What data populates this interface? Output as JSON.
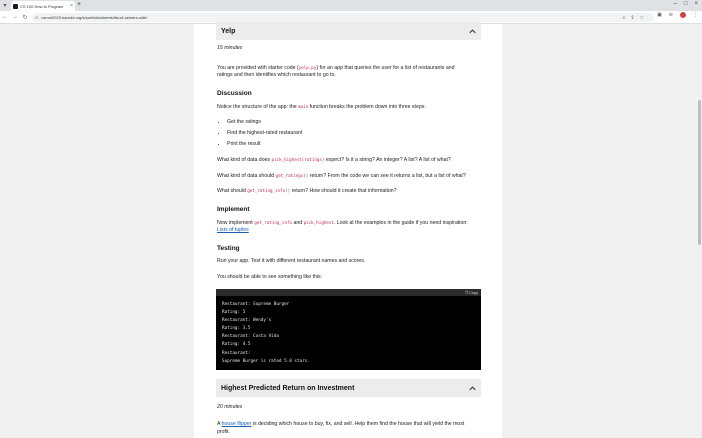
{
  "browser": {
    "tab_title": "CS 100 How to Program",
    "url": "csmm2023.harrold.org/s/portfolio/sheets/list-of-seiners-with/",
    "colors": {
      "accent": "#1a5fb4",
      "code_red": "#c7254e"
    }
  },
  "yelp": {
    "title": "Yelp",
    "time": "15 minutes",
    "intro_a": "You are provided with starter code (",
    "intro_code": "yelp.py",
    "intro_b": ") for an app that queries the user for a list of restaurants and",
    "intro_line2": "ratings and then identifies which restaurant to go to.",
    "discussion_heading": "Discussion",
    "discussion_a": "Notice the structure of the app: the ",
    "discussion_code": "main",
    "discussion_b": " function breaks the problem down into three steps:",
    "steps": [
      "Get the ratings",
      "Find the highest-rated restaurant",
      "Print the result"
    ],
    "q1_a": "What kind of data does ",
    "q1_code": "pick_highest(ratings)",
    "q1_b": " expect? Is it a string? An integer? A list? A list of what?",
    "q2_a": "What kind of data should ",
    "q2_code": "get_ratings()",
    "q2_b": " return? From the code we can see it returns a list, but a list of what?",
    "q3_a": "What should ",
    "q3_code": "get_rating_info()",
    "q3_b": " return? How should it create that information?",
    "implement_heading": "Implement",
    "impl_a": "Now implement ",
    "impl_code1": "get_rating_info",
    "impl_b": " and ",
    "impl_code2": "pick_highest",
    "impl_c": ". Look at the examples in the guide if you need inspiration:",
    "impl_link": "Lists of tuples",
    "testing_heading": "Testing",
    "test_line1": "Run your app. Test it with different restaurant names and scores.",
    "test_line2": "You should be able to see something like this:",
    "copy_label": "Copy",
    "code_lines": [
      "Restaurant: Supreme Burger",
      "Rating: 5",
      "Restaurant: Wendy's",
      "Rating: 3.5",
      "Restaurant: Costa Vida",
      "Rating: 4.5",
      "Restaurant:",
      "Supreme Burger is rated 5.0 stars."
    ]
  },
  "next": {
    "title": "Highest Predicted Return on Investment",
    "time": "20 minutes",
    "line_a": "A ",
    "line_link": "house flipper",
    "line_b": " is deciding which house to buy, fix, and sell. Help them find the house that will yield the most",
    "line2": "profit."
  }
}
